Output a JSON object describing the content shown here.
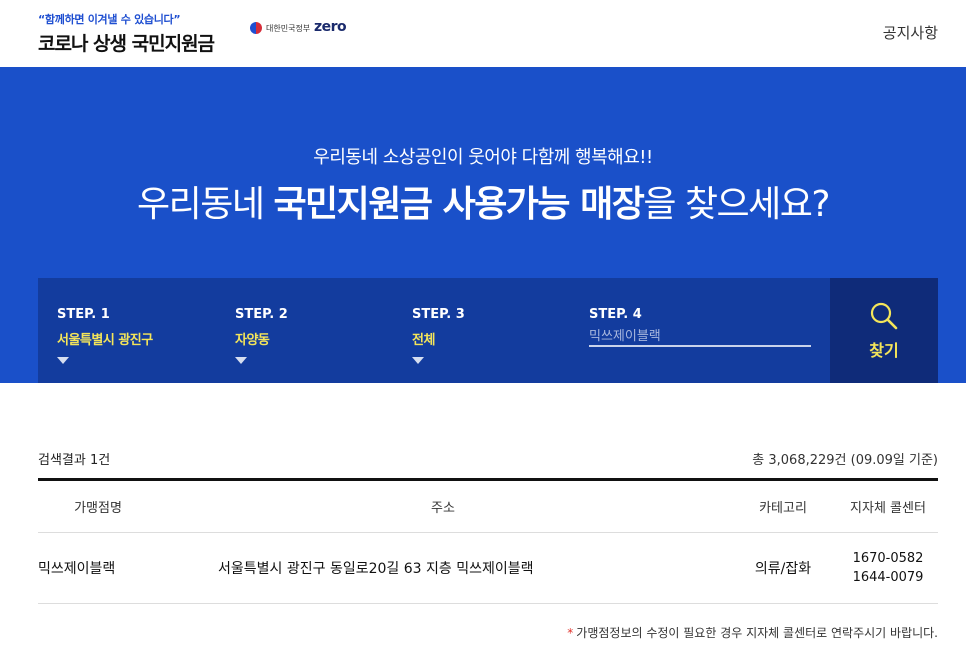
{
  "header": {
    "slogan": "“함께하면 이겨낼 수 있습니다”",
    "title": "코로나 상생 국민지원금",
    "gov_label": "대한민국정부",
    "partner_logo": "zero",
    "notice_link": "공지사항"
  },
  "hero": {
    "subtitle": "우리동네 소상공인이 웃어야 다함께 행복해요!!",
    "title_pre": "우리동네 ",
    "title_bold": "국민지원금 사용가능 매장",
    "title_post": "을 찾으세요?"
  },
  "search": {
    "steps": [
      {
        "label": "STEP. 1",
        "value": "서울특별시 광진구"
      },
      {
        "label": "STEP. 2",
        "value": "자양동"
      },
      {
        "label": "STEP. 3",
        "value": "전체"
      },
      {
        "label": "STEP. 4",
        "value": "",
        "placeholder": "믹쓰제이블랙"
      }
    ],
    "find_label": "찾기",
    "find_icon": "search-icon"
  },
  "results": {
    "count_text": "검색결과 1건",
    "total_text": "총 3,068,229건 (09.09일 기준)",
    "columns": [
      "가맹점명",
      "주소",
      "카테고리",
      "지자체 콜센터"
    ],
    "rows": [
      {
        "name": "믹쓰제이블랙",
        "address": "서울특별시 광진구 동일로20길 63 지층 믹쓰제이블랙",
        "category": "의류/잡화",
        "phone1": "1670-0582",
        "phone2": "1644-0079"
      }
    ],
    "footnote": "가맹점정보의 수정이 필요한 경우 지자체 콜센터로 연락주시기 바랍니다."
  },
  "colors": {
    "hero_bg": "#1a50c9",
    "search_bg": "#133c9e",
    "find_bg": "#0f2b79",
    "accent_yellow": "#f4e55a"
  }
}
